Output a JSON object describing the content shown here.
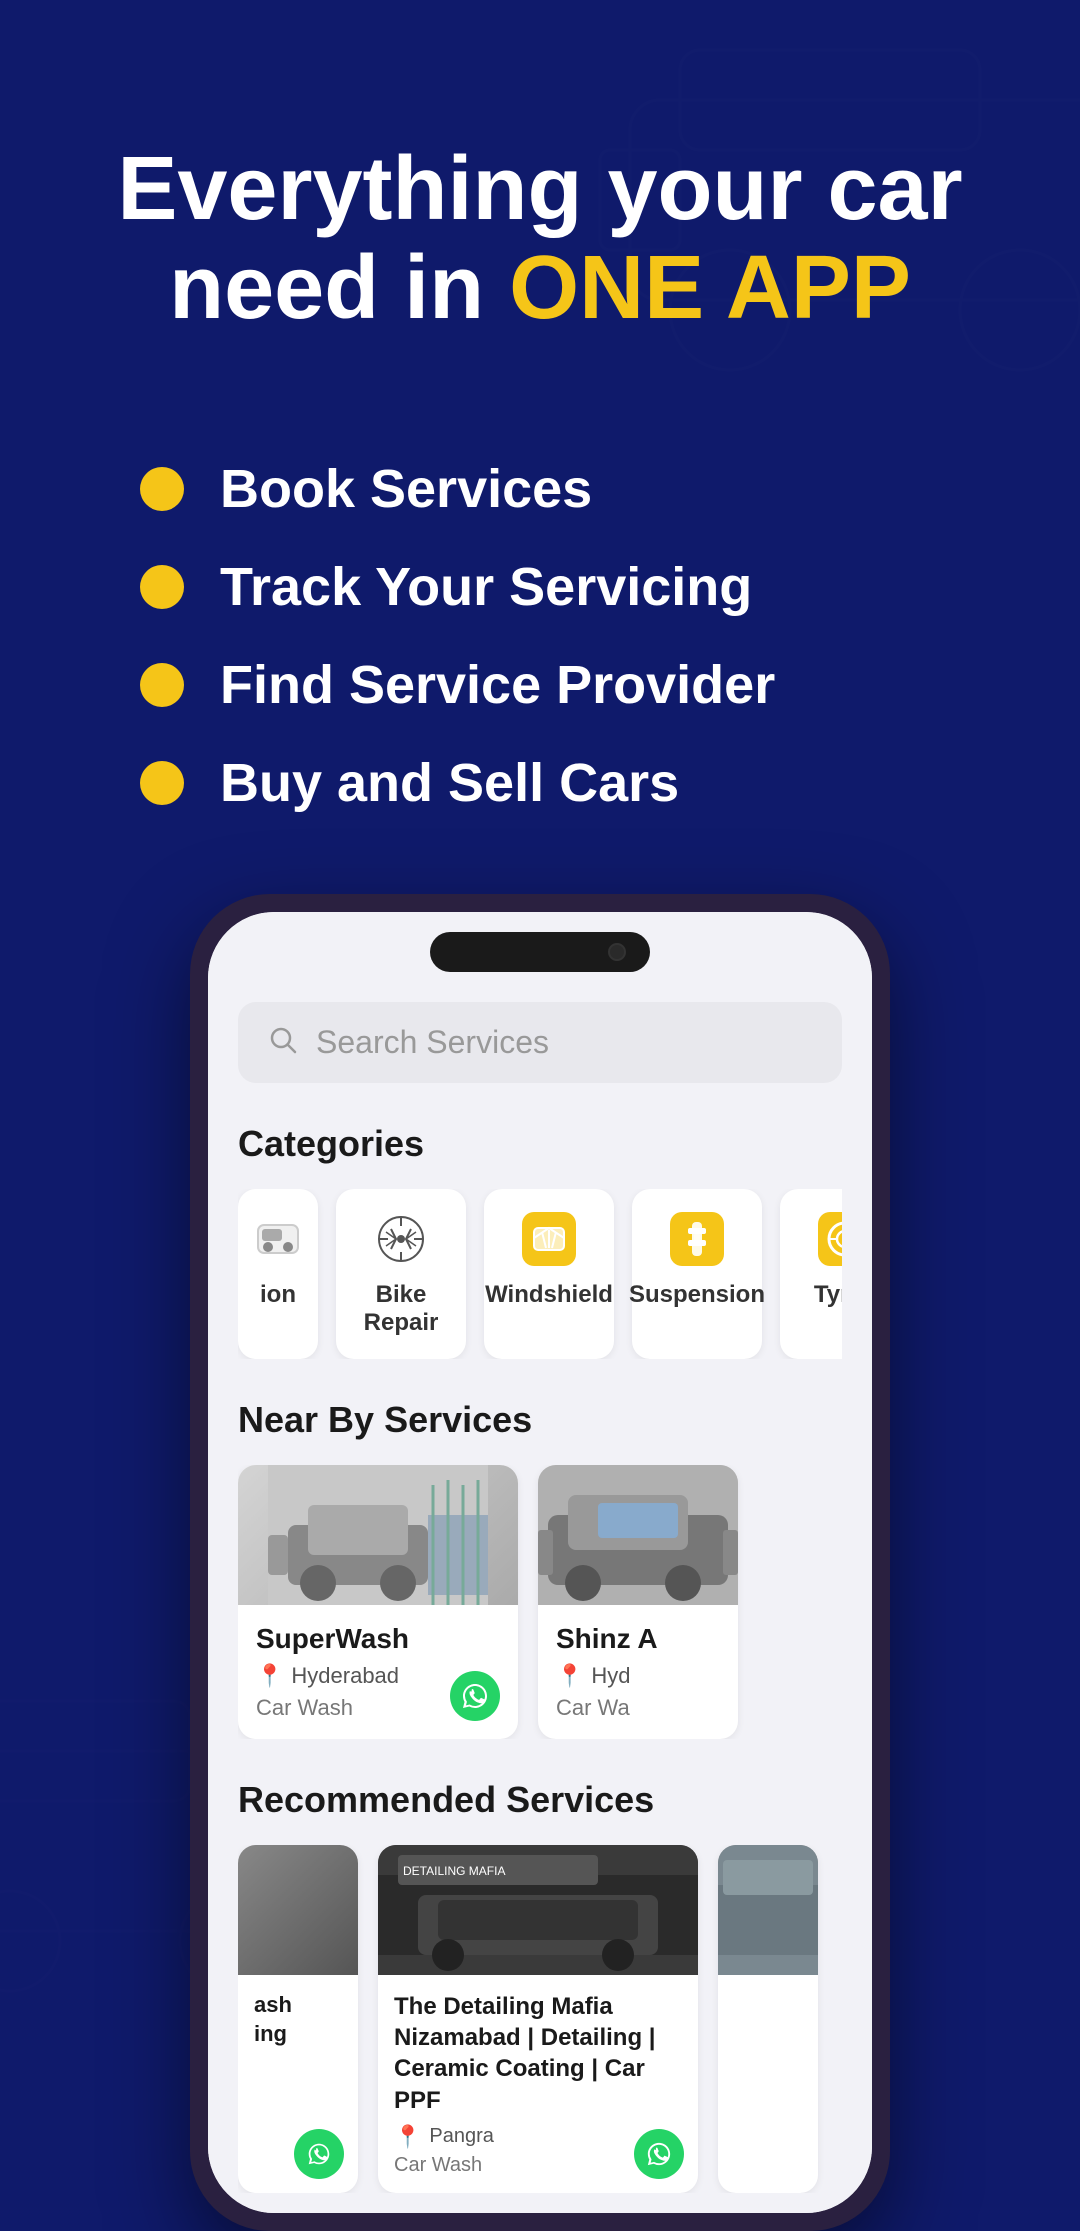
{
  "hero": {
    "title_line1": "Everything your car",
    "title_line2": "need in ",
    "title_highlight": "ONE APP"
  },
  "features": [
    {
      "text": "Book Services"
    },
    {
      "text": "Track Your Servicing"
    },
    {
      "text": "Find Service Provider"
    },
    {
      "text": "Buy and Sell Cars"
    }
  ],
  "phone": {
    "notch_alt": "Phone notch"
  },
  "app": {
    "search": {
      "placeholder": "Search Services"
    },
    "categories_title": "Categories",
    "categories": [
      {
        "label": "ion",
        "icon": "partial",
        "partial": true
      },
      {
        "label": "Bike Repair",
        "icon": "gear"
      },
      {
        "label": "Windshield",
        "icon": "windshield"
      },
      {
        "label": "Suspension",
        "icon": "suspension"
      },
      {
        "label": "Tyres",
        "icon": "tyre"
      }
    ],
    "nearby_title": "Near By Services",
    "nearby_services": [
      {
        "name": "SuperWash",
        "location": "Hyderabad",
        "type": "Car Wash",
        "has_whatsapp": true
      },
      {
        "name": "Shinz A",
        "location": "Hyd",
        "type": "Car Wa",
        "has_whatsapp": false,
        "partial": true
      }
    ],
    "recommended_title": "Recommended Services",
    "recommended_services": [
      {
        "name": "ash\ning",
        "partial_left": true
      },
      {
        "name": "The Detailing Mafia Nizamabad | Detailing | Ceramic Coating | Car PPF",
        "location": "Pangra",
        "type": "Car Wash",
        "has_whatsapp": true
      },
      {
        "name": "",
        "partial_right": true
      }
    ]
  },
  "colors": {
    "bg_dark": "#0f1a6b",
    "accent_yellow": "#f5c518",
    "text_white": "#ffffff",
    "phone_border": "#2a2040"
  }
}
